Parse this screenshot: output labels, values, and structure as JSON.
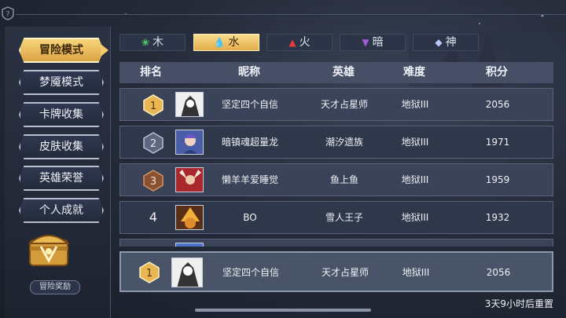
{
  "help_icon": "question-shield-icon",
  "nav": {
    "items": [
      {
        "label": "冒险模式",
        "active": true
      },
      {
        "label": "梦魇模式",
        "active": false
      },
      {
        "label": "卡牌收集",
        "active": false
      },
      {
        "label": "皮肤收集",
        "active": false
      },
      {
        "label": "英雄荣誉",
        "active": false
      },
      {
        "label": "个人成就",
        "active": false
      }
    ],
    "reward_label": "冒险奖励",
    "reward_icon": "treasure-chest-icon"
  },
  "tabs": [
    {
      "label": "木",
      "icon": "leaf-icon",
      "icon_color": "#55c56a"
    },
    {
      "label": "水",
      "icon": "water-drop-icon",
      "icon_color": "#1e7fbf",
      "active": true
    },
    {
      "label": "火",
      "icon": "flame-icon",
      "icon_color": "#e23b3b"
    },
    {
      "label": "暗",
      "icon": "dark-triangle-icon",
      "icon_color": "#a35bd8"
    },
    {
      "label": "神",
      "icon": "divine-crystal-icon",
      "icon_color": "#b9c6ff"
    }
  ],
  "table": {
    "headers": {
      "rank": "排名",
      "name": "昵称",
      "hero": "英雄",
      "difficulty": "难度",
      "score": "积分"
    },
    "rows": [
      {
        "rank": "1",
        "name": "坚定四个自信",
        "hero": "天才占星师",
        "difficulty": "地狱III",
        "score": "2056"
      },
      {
        "rank": "2",
        "name": "暗镇魂超量龙",
        "hero": "潮汐遗族",
        "difficulty": "地狱III",
        "score": "1971"
      },
      {
        "rank": "3",
        "name": "懒羊羊爱睡觉",
        "hero": "鱼上鱼",
        "difficulty": "地狱III",
        "score": "1959"
      },
      {
        "rank": "4",
        "name": "BO",
        "hero": "雪人王子",
        "difficulty": "地狱III",
        "score": "1932"
      }
    ]
  },
  "my_rank": {
    "rank": "1",
    "name": "坚定四个自信",
    "hero": "天才占星师",
    "difficulty": "地狱III",
    "score": "2056"
  },
  "reset_text": "3天9小时后重置",
  "colors": {
    "gold": "#e8b653",
    "silver": "#9aa6bd",
    "bronze": "#b06a3a"
  }
}
